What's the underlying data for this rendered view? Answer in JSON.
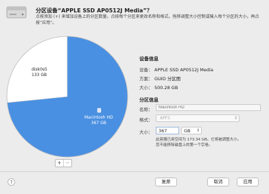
{
  "header": {
    "title": "分区设备“APPLE SSD AP0512J Media”？",
    "description_lines": [
      "点按添加 (+) 来增加设备上的分区数量。点按每个分区来更改名称和格式。拖移调整大小控制或输入每个分区的大小。再点",
      "按“应用”。"
    ]
  },
  "chart_data": {
    "type": "pie",
    "series": [
      {
        "name": "disk0s5",
        "value_gb": 133,
        "color": "#ffffff"
      },
      {
        "name": "Macintosh HD",
        "value_gb": 367,
        "color": "#4a90e2"
      }
    ]
  },
  "pie": {
    "slices": [
      {
        "name": "disk0s5",
        "size": "133 GB"
      },
      {
        "name": "Macintosh HD",
        "size": "367 GB"
      }
    ],
    "add_label": "+",
    "remove_label": "−"
  },
  "device_info": {
    "heading": "设备信息",
    "rows": [
      {
        "key": "设备：",
        "value": "APPLE SSD AP0512J Media"
      },
      {
        "key": "方案：",
        "value": "GUID 分区图"
      },
      {
        "key": "大小：",
        "value": "500.28 GB"
      }
    ]
  },
  "partition_info": {
    "heading": "分区信息",
    "name_label": "名称：",
    "name_placeholder": "Macintosh HD",
    "format_label": "格式：",
    "format_value": "APFS",
    "size_label": "大小：",
    "size_value": "367",
    "size_unit": "GB",
    "note_lines": [
      "此容器已用空间为 173.34 GB。它将被调整大小。",
      "您不能移除磁盘上的第一个宗卷。"
    ]
  },
  "footer": {
    "help": "?",
    "revert": "复原",
    "cancel": "取消",
    "apply": "应用"
  },
  "colors": {
    "pie_blue": "#4a90e2",
    "pie_white": "#ffffff",
    "accent": "#3478f6"
  }
}
